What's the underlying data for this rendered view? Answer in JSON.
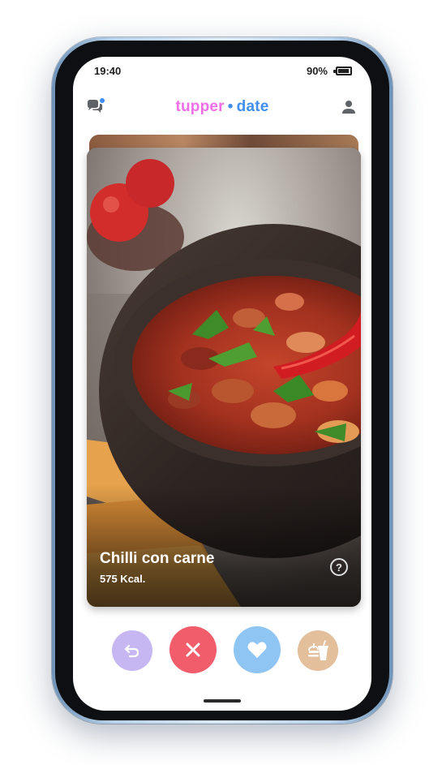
{
  "status_bar": {
    "time": "19:40",
    "battery": "90%"
  },
  "header": {
    "logo_part1": "tupper",
    "logo_separator": "•",
    "logo_part2": "date",
    "left_icon": "chat-bubbles-icon",
    "right_icon": "person-icon"
  },
  "card": {
    "title": "Chilli con carne",
    "calories": "575 Kcal.",
    "info_label": "?",
    "image": "bowl of chilli con carne with beans, red chili and parsley, tortilla chips"
  },
  "actions": [
    {
      "name": "undo",
      "icon": "undo-arrow-icon",
      "color": "#c6b7f3"
    },
    {
      "name": "nope",
      "icon": "close-icon",
      "color": "#f25d6c"
    },
    {
      "name": "like",
      "icon": "heart-icon",
      "color": "#8fc5f3"
    },
    {
      "name": "order",
      "icon": "takeaway-icon",
      "color": "#e3bf9c"
    }
  ],
  "colors": {
    "brand_pink": "#f06ee8",
    "brand_blue": "#3f8ef0"
  }
}
